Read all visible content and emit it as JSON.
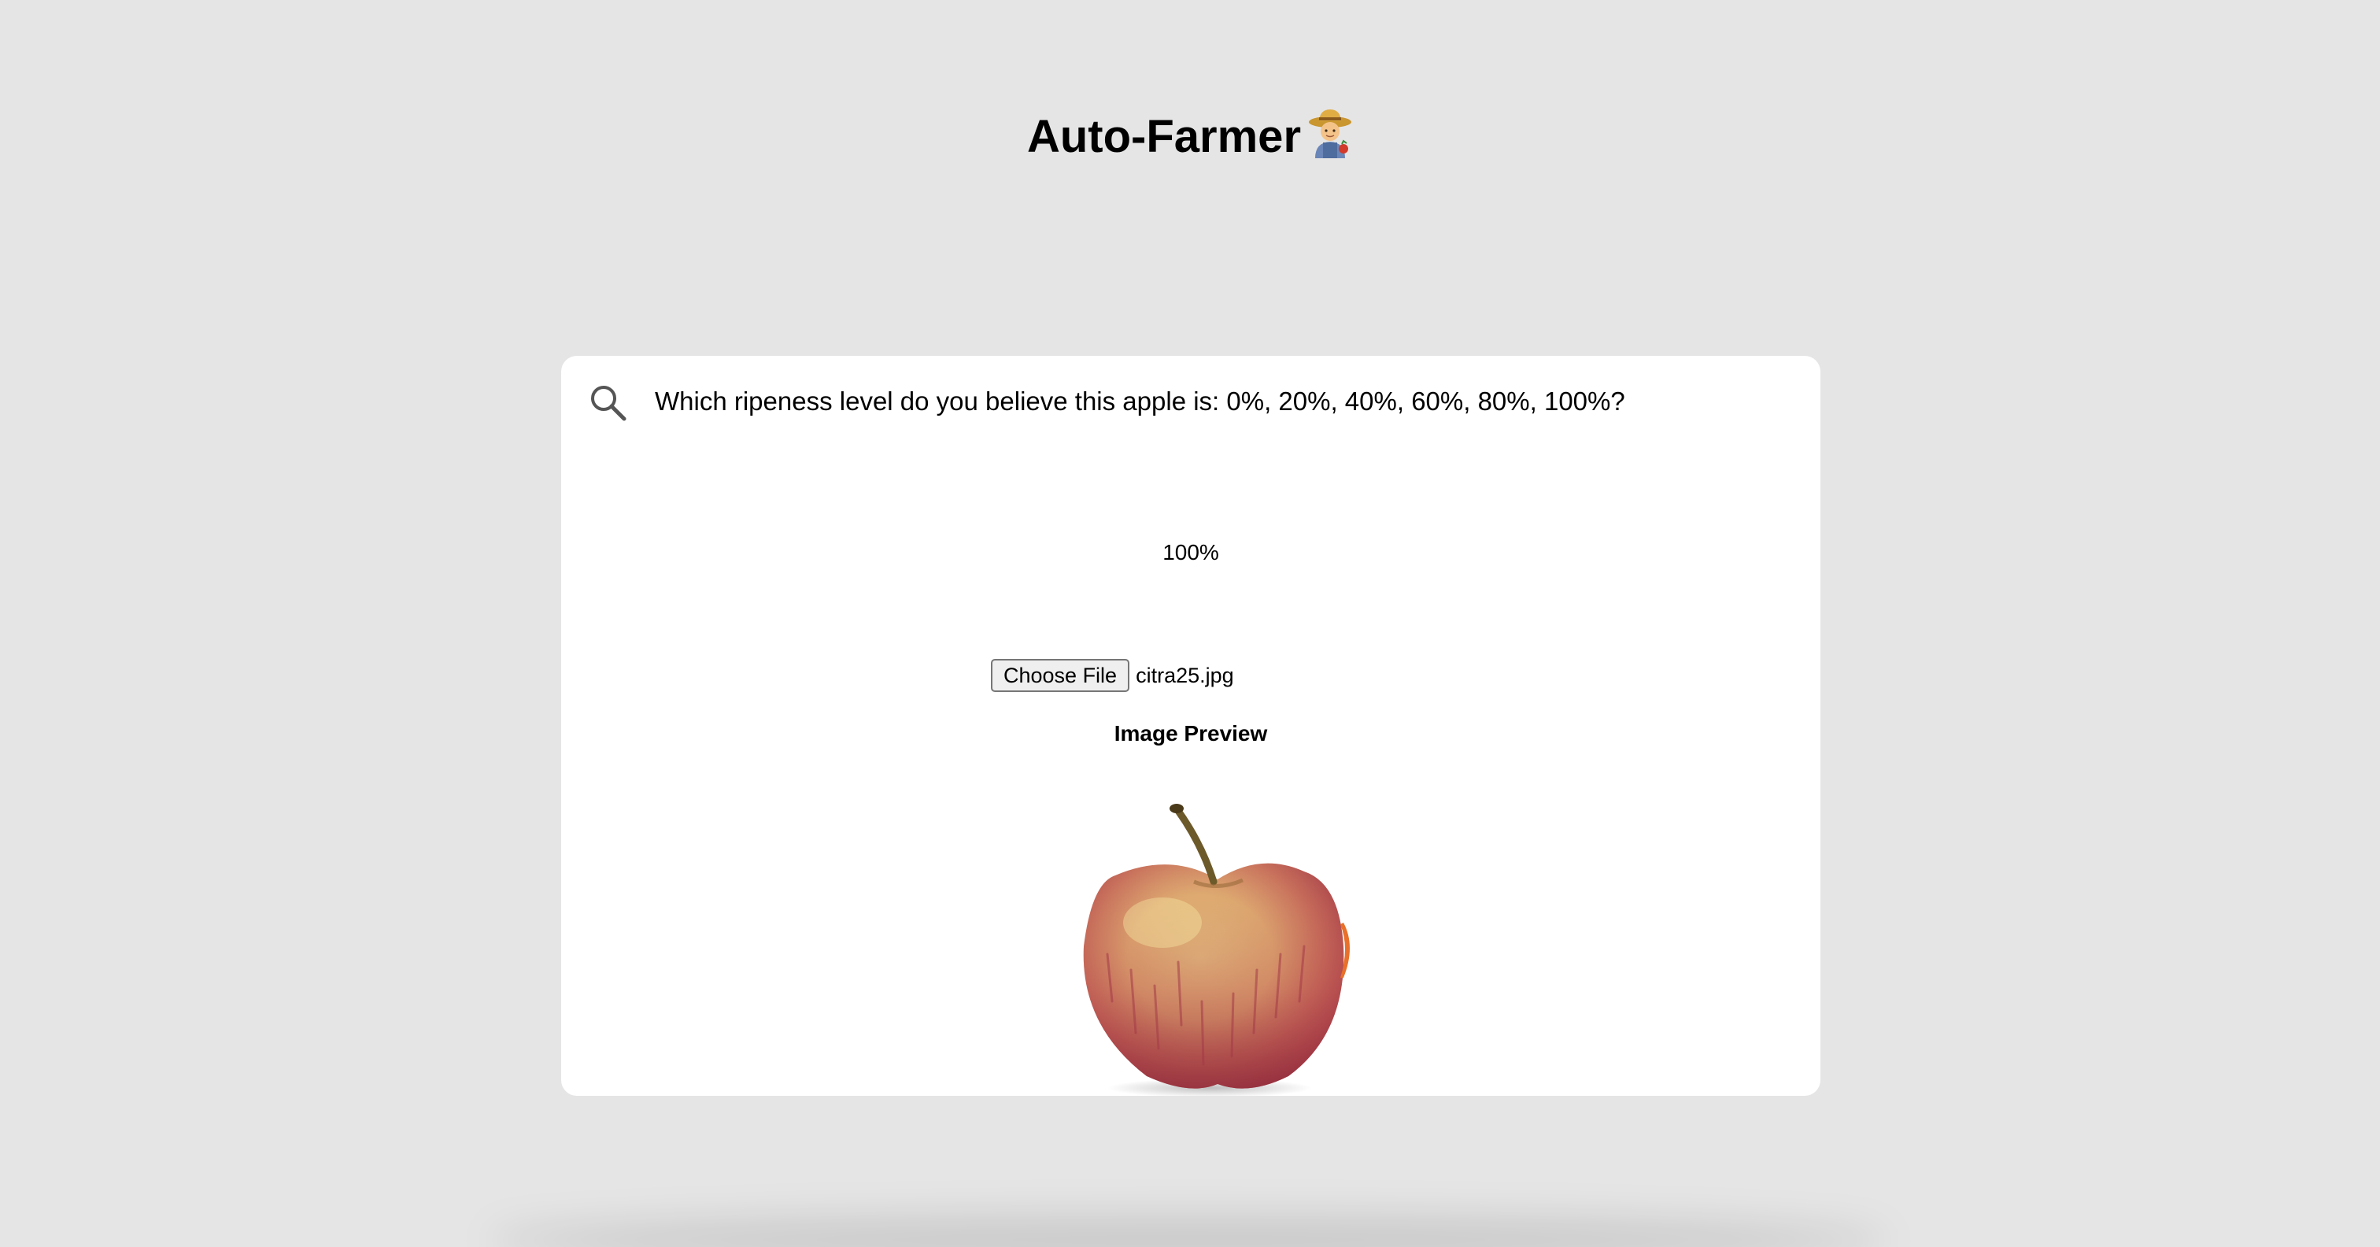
{
  "header": {
    "title": "Auto-Farmer",
    "title_emoji_icon": "farmer-emoji"
  },
  "search": {
    "icon": "search-icon",
    "query": "Which ripeness level do you believe this apple is: 0%, 20%, 40%, 60%, 80%, 100%?"
  },
  "result": {
    "value": "100%"
  },
  "file_input": {
    "button_label": "Choose File",
    "file_name": "citra25.jpg"
  },
  "preview": {
    "label": "Image Preview",
    "image": "apple-image"
  },
  "colors": {
    "page_background": "#e5e5e5",
    "card_background": "#ffffff",
    "text": "#000000"
  }
}
